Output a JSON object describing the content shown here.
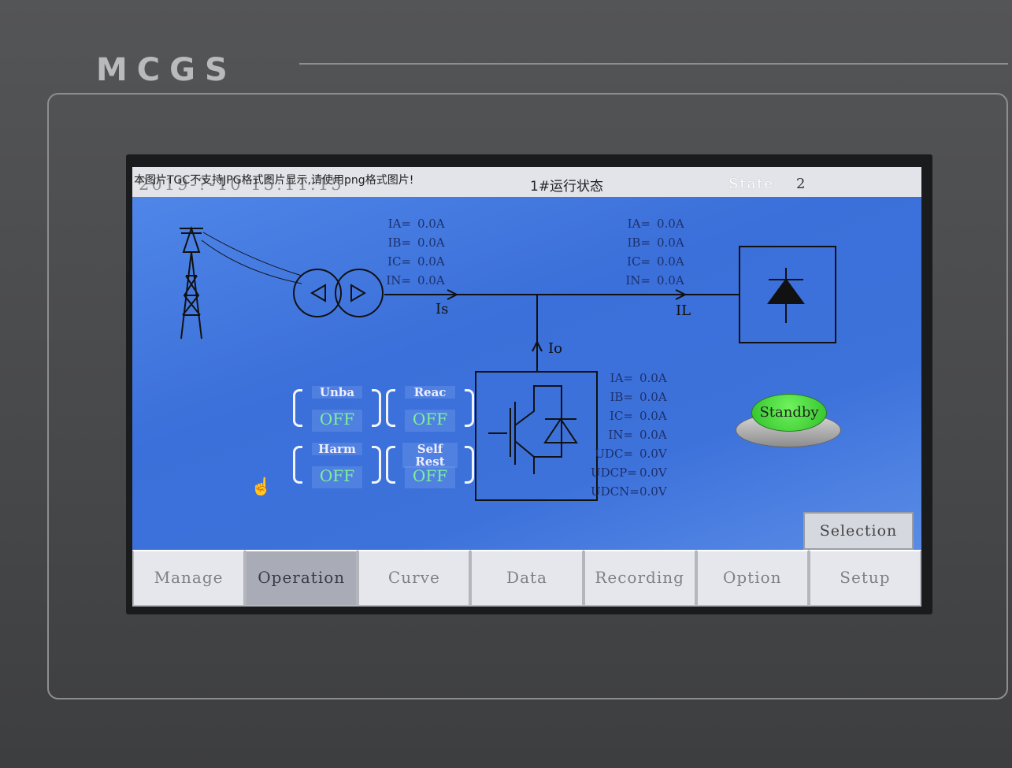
{
  "device": {
    "brand": "MCGS"
  },
  "header": {
    "datetime": "2019-?-10 15:11:15",
    "error_message": "本图片TGC不支持JPG格式图片显示,请使用png格式图片!",
    "title": "1#运行状态",
    "state_label": "State",
    "state_value": "2"
  },
  "source_measurements": [
    {
      "k": "IA=",
      "v": "0.0A"
    },
    {
      "k": "IB=",
      "v": "0.0A"
    },
    {
      "k": "IC=",
      "v": "0.0A"
    },
    {
      "k": "IN=",
      "v": "0.0A"
    }
  ],
  "load_measurements": [
    {
      "k": "IA=",
      "v": "0.0A"
    },
    {
      "k": "IB=",
      "v": "0.0A"
    },
    {
      "k": "IC=",
      "v": "0.0A"
    },
    {
      "k": "IN=",
      "v": "0.0A"
    }
  ],
  "converter_measurements": [
    {
      "k": "IA=",
      "v": "0.0A"
    },
    {
      "k": "IB=",
      "v": "0.0A"
    },
    {
      "k": "IC=",
      "v": "0.0A"
    },
    {
      "k": "IN=",
      "v": "0.0A"
    },
    {
      "k": "UDC=",
      "v": "0.0V"
    },
    {
      "k": "UDCP=",
      "v": "0.0V"
    },
    {
      "k": "UDCN=",
      "v": "0.0V"
    }
  ],
  "diagram_labels": {
    "is": "Is",
    "il": "IL",
    "io": "Io"
  },
  "functions": [
    {
      "label": "Unba",
      "state": "OFF"
    },
    {
      "label": "Reac",
      "state": "OFF"
    },
    {
      "label": "Harm",
      "state": "OFF"
    },
    {
      "label": "Self Rest",
      "state": "OFF"
    }
  ],
  "standby_button": {
    "label": "Standby",
    "color": "#3fd63a"
  },
  "selection_button": "Selection",
  "nav": {
    "active": "Operation",
    "tabs": [
      "Manage",
      "Operation",
      "Curve",
      "Data",
      "Recording",
      "Option",
      "Setup"
    ]
  }
}
